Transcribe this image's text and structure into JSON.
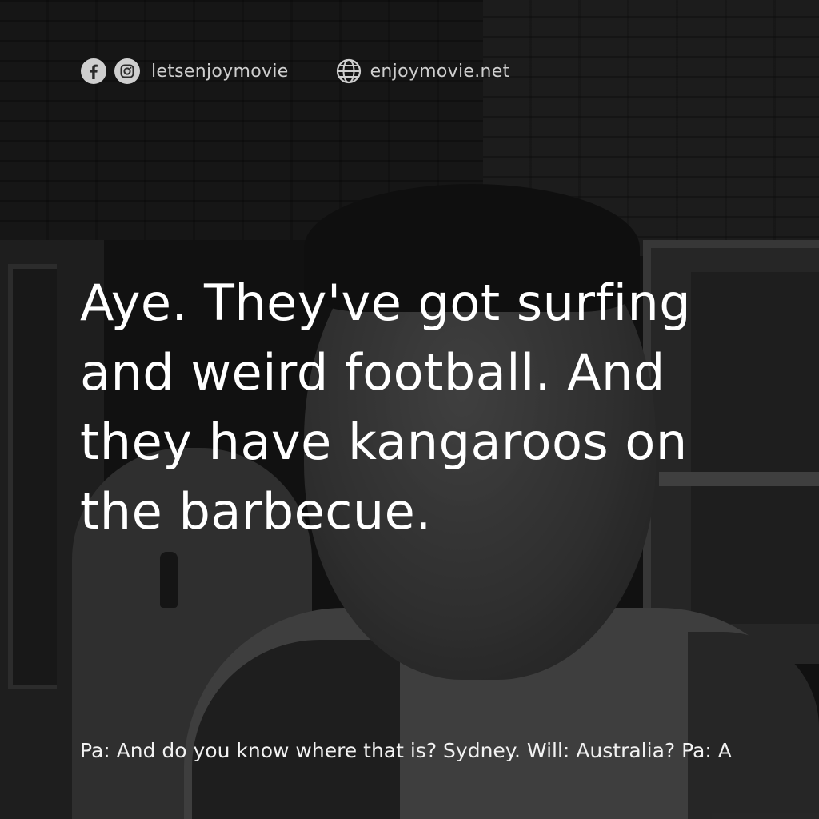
{
  "header": {
    "icons": [
      "facebook-icon",
      "instagram-icon",
      "globe-icon"
    ],
    "social_handle": "letsenjoymovie",
    "website": "enjoymovie.net"
  },
  "quote": {
    "text": "Aye. They've got surfing and weird football. And they have kangaroos on the barbecue."
  },
  "context": {
    "text": "Pa: And do you know where that is? Sydney. Will: Australia? Pa: A"
  },
  "colors": {
    "text": "#ffffff",
    "header_text": "#cfcfcf",
    "overlay": "rgba(0,0,0,0.48)"
  }
}
